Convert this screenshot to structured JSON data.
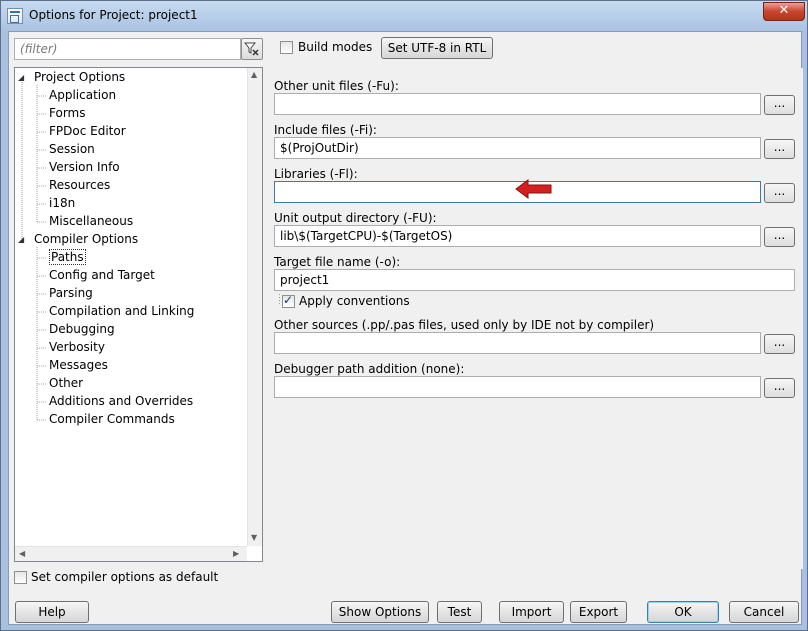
{
  "window": {
    "title": "Options for Project: project1",
    "close_glyph": "✕"
  },
  "filter": {
    "placeholder": "(filter)"
  },
  "tree": {
    "groups": [
      {
        "label": "Project Options",
        "items": [
          "Application",
          "Forms",
          "FPDoc Editor",
          "Session",
          "Version Info",
          "Resources",
          "i18n",
          "Miscellaneous"
        ]
      },
      {
        "label": "Compiler Options",
        "items": [
          "Paths",
          "Config and Target",
          "Parsing",
          "Compilation and Linking",
          "Debugging",
          "Verbosity",
          "Messages",
          "Other",
          "Additions and Overrides",
          "Compiler Commands"
        ]
      }
    ],
    "selected": "Paths"
  },
  "top": {
    "build_modes_label": "Build modes",
    "build_modes_checked": false,
    "utf8_button": "Set UTF-8 in RTL"
  },
  "paths": {
    "other_unit_files": {
      "label": "Other unit files (-Fu):",
      "value": ""
    },
    "include_files": {
      "label": "Include files (-Fi):",
      "value": "$(ProjOutDir)"
    },
    "libraries": {
      "label": "Libraries (-Fl):",
      "value": ""
    },
    "unit_output_dir": {
      "label": "Unit output directory (-FU):",
      "value": "lib\\$(TargetCPU)-$(TargetOS)"
    },
    "target_file_name": {
      "label": "Target file name (-o):",
      "value": "project1"
    },
    "apply_conventions": {
      "label": "Apply conventions",
      "checked": true
    },
    "other_sources": {
      "label": "Other sources (.pp/.pas files, used only by IDE not by compiler)",
      "value": ""
    },
    "debugger_path": {
      "label": "Debugger path addition (none):",
      "value": ""
    },
    "browse_label": "..."
  },
  "footer": {
    "default_checkbox_label": "Set compiler options as default",
    "default_checked": false,
    "help": "Help",
    "show_options": "Show Options",
    "test": "Test",
    "import": "Import",
    "export": "Export",
    "ok": "OK",
    "cancel": "Cancel"
  },
  "colors": {
    "annotation_arrow": "#d42020"
  }
}
